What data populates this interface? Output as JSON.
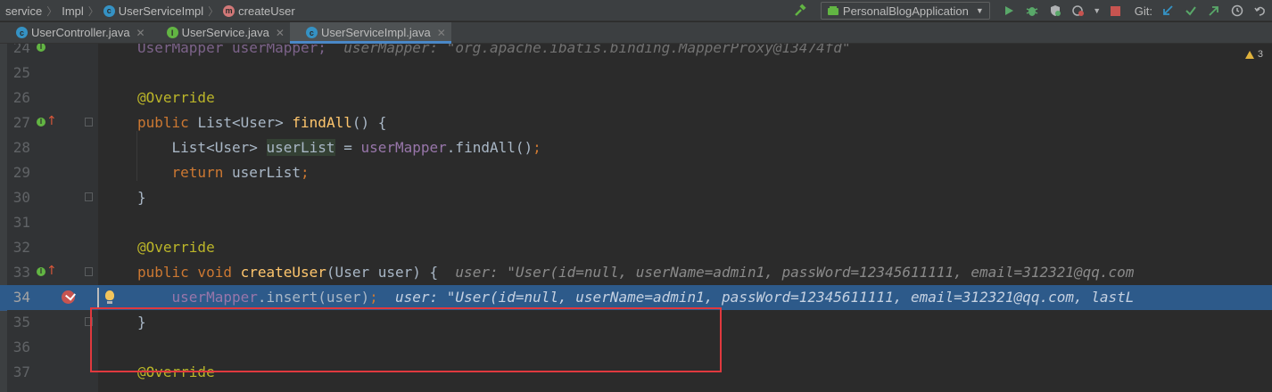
{
  "breadcrumb": {
    "items": [
      "service",
      "Impl",
      "UserServiceImpl",
      "createUser"
    ],
    "icons": [
      "",
      "",
      "class-icon",
      "method-icon"
    ]
  },
  "toolbar": {
    "run_config": "PersonalBlogApplication",
    "git_label": "Git:"
  },
  "tabs": [
    {
      "label": "UserController.java",
      "icon": "class-icon",
      "active": false
    },
    {
      "label": "UserService.java",
      "icon": "interface-icon",
      "active": false
    },
    {
      "label": "UserServiceImpl.java",
      "icon": "class-icon",
      "active": true
    }
  ],
  "inspections": {
    "warnings": "3"
  },
  "editor": {
    "lines": [
      {
        "n": "24",
        "parts": [
          {
            "t": "UserMapper userMapper;",
            "c": "fld"
          },
          {
            "t": "  userMapper: \"org.apache.ibatis.binding.MapperProxy@13474fd\"",
            "c": "hint"
          }
        ]
      },
      {
        "n": "25",
        "parts": []
      },
      {
        "n": "26",
        "parts": [
          {
            "t": "@Override",
            "c": "ann"
          }
        ]
      },
      {
        "n": "27",
        "parts": [
          {
            "t": "public ",
            "c": "kw"
          },
          {
            "t": "List<User> ",
            "c": ""
          },
          {
            "t": "findAll",
            "c": "fn"
          },
          {
            "t": "() {",
            "c": ""
          }
        ]
      },
      {
        "n": "28",
        "parts": [
          {
            "t": "    List<User> ",
            "c": ""
          },
          {
            "t": "userList",
            "c": "hl-var"
          },
          {
            "t": " = ",
            "c": ""
          },
          {
            "t": "userMapper",
            "c": "fld"
          },
          {
            "t": ".findAll()",
            "c": ""
          },
          {
            "t": ";",
            "c": "kw"
          }
        ]
      },
      {
        "n": "29",
        "parts": [
          {
            "t": "    ",
            "c": ""
          },
          {
            "t": "return ",
            "c": "kw"
          },
          {
            "t": "userList",
            "c": ""
          },
          {
            "t": ";",
            "c": "kw"
          }
        ]
      },
      {
        "n": "30",
        "parts": [
          {
            "t": "}",
            "c": ""
          }
        ]
      },
      {
        "n": "31",
        "parts": []
      },
      {
        "n": "32",
        "parts": [
          {
            "t": "@Override",
            "c": "ann"
          }
        ]
      },
      {
        "n": "33",
        "parts": [
          {
            "t": "public void ",
            "c": "kw"
          },
          {
            "t": "createUser",
            "c": "fn"
          },
          {
            "t": "(User user) {",
            "c": ""
          },
          {
            "t": "  user: \"User(id=null, userName=admin1, passWord=12345611111, email=312321@qq.com",
            "c": "hint"
          }
        ]
      },
      {
        "n": "34",
        "parts": [
          {
            "t": "    ",
            "c": ""
          },
          {
            "t": "userMapper",
            "c": "fld"
          },
          {
            "t": ".insert(user)",
            "c": ""
          },
          {
            "t": ";",
            "c": "kw"
          },
          {
            "t": "  user: \"User(id=null, userName=admin1, passWord=12345611111, email=312321@qq.com, lastL",
            "c": "hint"
          }
        ]
      },
      {
        "n": "35",
        "parts": [
          {
            "t": "}",
            "c": ""
          }
        ]
      },
      {
        "n": "36",
        "parts": []
      },
      {
        "n": "37",
        "parts": [
          {
            "t": "@Override",
            "c": "ann"
          }
        ]
      }
    ]
  },
  "colors": {
    "background": "#2b2b2b",
    "keyword": "#cc7832",
    "annotation": "#bbb529",
    "method": "#ffc66d",
    "field": "#9876aa",
    "execution_line": "#2d5a8a",
    "breakpoint": "#c75450",
    "annotation_box": "#e0393e"
  }
}
